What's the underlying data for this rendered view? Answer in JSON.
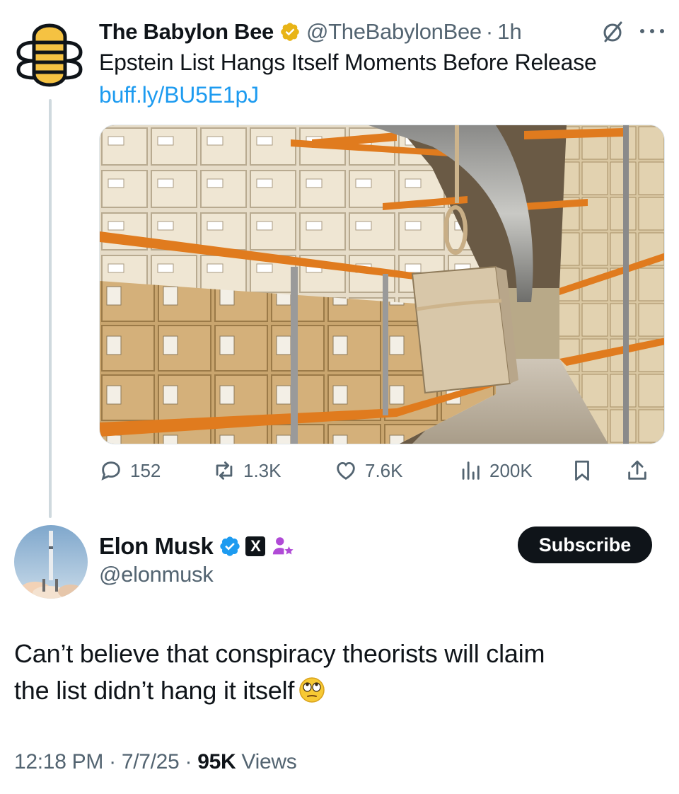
{
  "quoted_tweet": {
    "display_name": "The Babylon Bee",
    "handle": "@TheBabylonBee",
    "separator": "·",
    "time": "1h",
    "text": "Epstein List Hangs Itself Moments Before Release",
    "link": "buff.ly/BU5E1pJ",
    "stats": {
      "replies": "152",
      "reposts": "1.3K",
      "likes": "7.6K",
      "views": "200K"
    }
  },
  "main_tweet": {
    "display_name": "Elon Musk",
    "handle": "@elonmusk",
    "x_badge": "X",
    "subscribe_label": "Subscribe",
    "text_line1": "Can’t believe that conspiracy theorists will claim",
    "text_line2": "the list didn’t hang it itself",
    "time": "12:18 PM",
    "sep1": "·",
    "date": "7/7/25",
    "sep2": "·",
    "views_count": "95K",
    "views_label": "Views"
  },
  "colors": {
    "link_blue": "#1d9bf0",
    "muted": "#536471",
    "text": "#0f1419",
    "gold_badge": "#e8b417",
    "blue_badge": "#1d9bf0",
    "bee_yellow": "#f5c242"
  }
}
